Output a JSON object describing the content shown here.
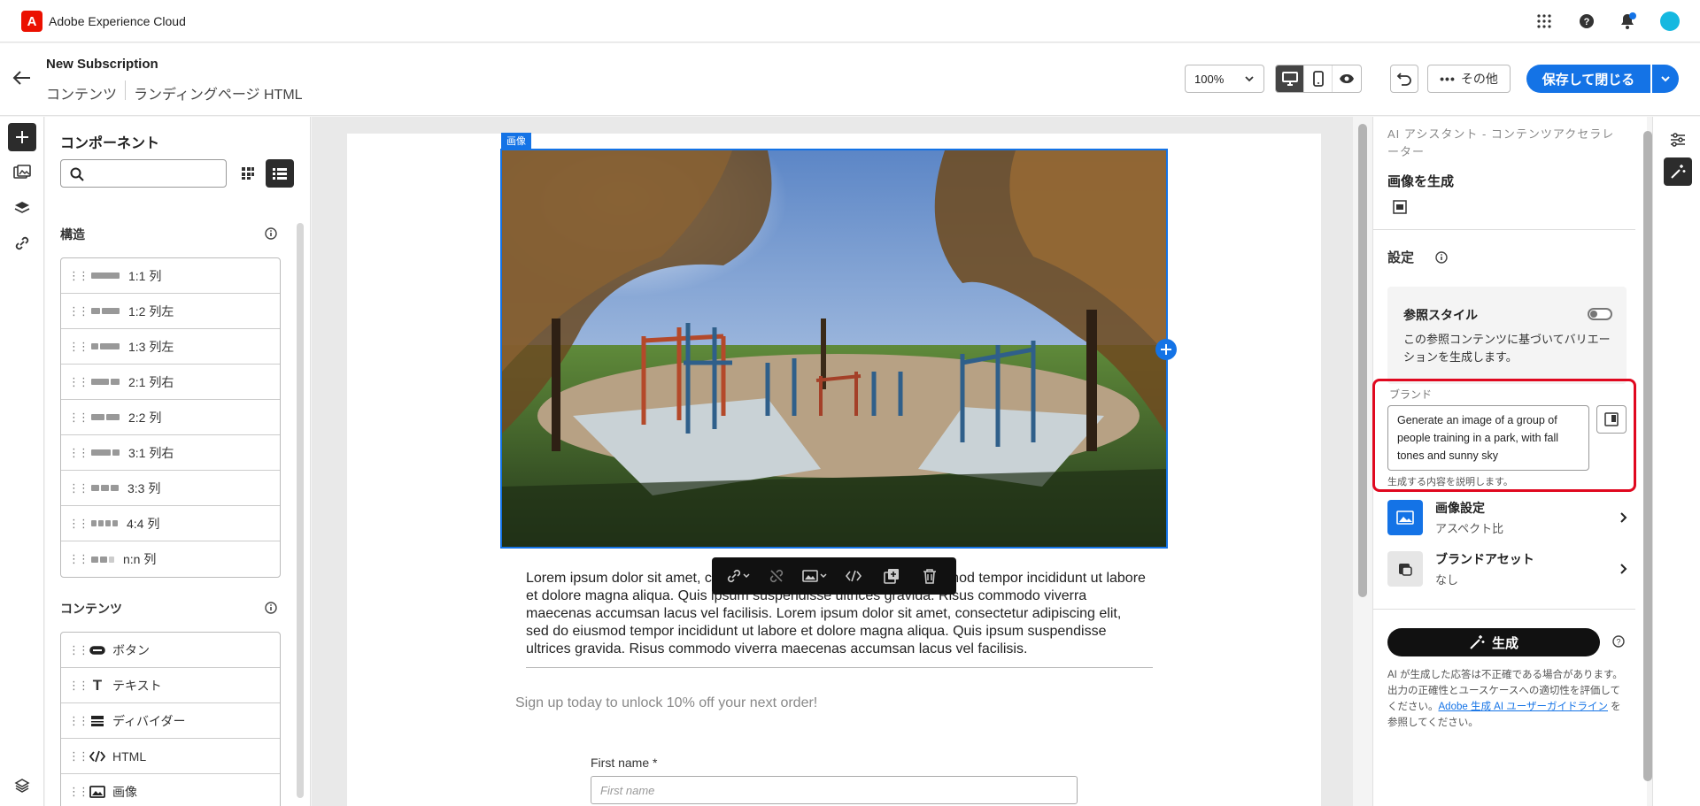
{
  "app": {
    "title": "Adobe Experience Cloud",
    "logo_letter": "A"
  },
  "header": {
    "title": "New Subscription",
    "breadcrumb": [
      "コンテンツ",
      "ランディングページ HTML"
    ],
    "zoom": "100%",
    "more_label": "その他",
    "save_label": "保存して閉じる"
  },
  "components": {
    "title": "コンポーネント",
    "search_placeholder": "",
    "structure_label": "構造",
    "structure_items": [
      "1:1 列",
      "1:2 列左",
      "1:3 列左",
      "2:1 列右",
      "2:2 列",
      "3:1 列右",
      "3:3 列",
      "4:4 列",
      "n:n 列"
    ],
    "content_label": "コンテンツ",
    "content_items": [
      "ボタン",
      "テキスト",
      "ディバイダー",
      "HTML",
      "画像"
    ]
  },
  "canvas": {
    "image_label": "画像",
    "body_text": "Lorem ipsum dolor sit amet, consectetur adipiscing elit, sed do eiusmod tempor incididunt ut labore et dolore magna aliqua. Quis ipsum suspendisse ultrices gravida. Risus commodo viverra maecenas accumsan lacus vel facilisis. Lorem ipsum dolor sit amet, consectetur adipiscing elit, sed do eiusmod tempor incididunt ut labore et dolore magna aliqua. Quis ipsum suspendisse ultrices gravida. Risus commodo viverra maecenas accumsan lacus vel facilisis.",
    "signup_text": "Sign up today to unlock 10% off your next order!",
    "first_name_label": "First name",
    "first_name_required": "*",
    "first_name_placeholder": "First name"
  },
  "assistant": {
    "title": "AI アシスタント - コンテンツアクセラレーター",
    "subtitle": "画像を生成",
    "settings_label": "設定",
    "ref_style_label": "参照スタイル",
    "ref_style_desc": "この参照コンテンツに基づいてバリエーションを生成します。",
    "ref_style_enabled": false,
    "brand_label": "ブランド",
    "prompt_value": "Generate an image of a group of people training in a park, with fall tones and sunny sky",
    "prompt_help": "生成する内容を説明します。",
    "image_settings_label": "画像設定",
    "image_settings_value": "アスペクト比",
    "brand_assets_label": "ブランドアセット",
    "brand_assets_value": "なし",
    "generate_label": "生成",
    "disclaimer_pre": "AI が生成した応答は不正確である場合があります。出力の正確性とユースケースへの適切性を評価してください。",
    "disclaimer_link": "Adobe 生成 AI ユーザーガイドライン",
    "disclaimer_post": " を参照してください。"
  },
  "colors": {
    "accent": "#1473e6",
    "highlight": "#e0081f",
    "brand": "#eb1000"
  }
}
